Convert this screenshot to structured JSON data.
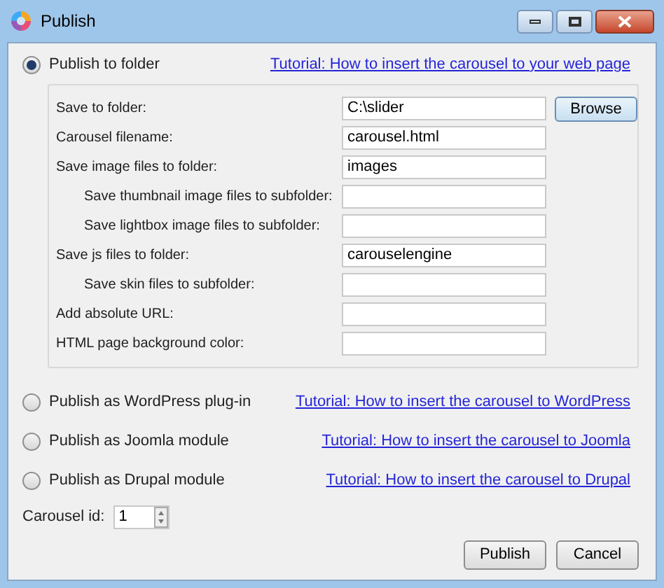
{
  "window": {
    "title": "Publish"
  },
  "options": [
    {
      "label": "Publish to folder",
      "selected": true,
      "link": "Tutorial: How to insert the carousel to your web page"
    },
    {
      "label": "Publish as WordPress plug-in",
      "selected": false,
      "link": "Tutorial: How to insert the carousel to WordPress"
    },
    {
      "label": "Publish as Joomla module",
      "selected": false,
      "link": "Tutorial: How to insert the carousel to Joomla"
    },
    {
      "label": "Publish as Drupal module",
      "selected": false,
      "link": "Tutorial: How to insert the carousel to Drupal"
    }
  ],
  "folder_fields": [
    {
      "label": "Save to folder:",
      "value": "C:\\slider",
      "button": "Browse"
    },
    {
      "label": "Carousel filename:",
      "value": "carousel.html"
    },
    {
      "label": "Save image files to folder:",
      "value": "images",
      "children": [
        {
          "label": "Save thumbnail image files to subfolder:"
        },
        {
          "label": "Save lightbox image files to subfolder:"
        }
      ]
    },
    {
      "label": "Save js files to folder:",
      "value": "carouselengine",
      "children": [
        {
          "label": "Save skin files to subfolder:"
        }
      ]
    },
    {
      "label": "Add absolute URL:"
    },
    {
      "label": "HTML page background color:"
    }
  ],
  "carousel_id": {
    "label": "Carousel id:",
    "value": "1"
  },
  "buttons": [
    "Publish",
    "Cancel"
  ]
}
